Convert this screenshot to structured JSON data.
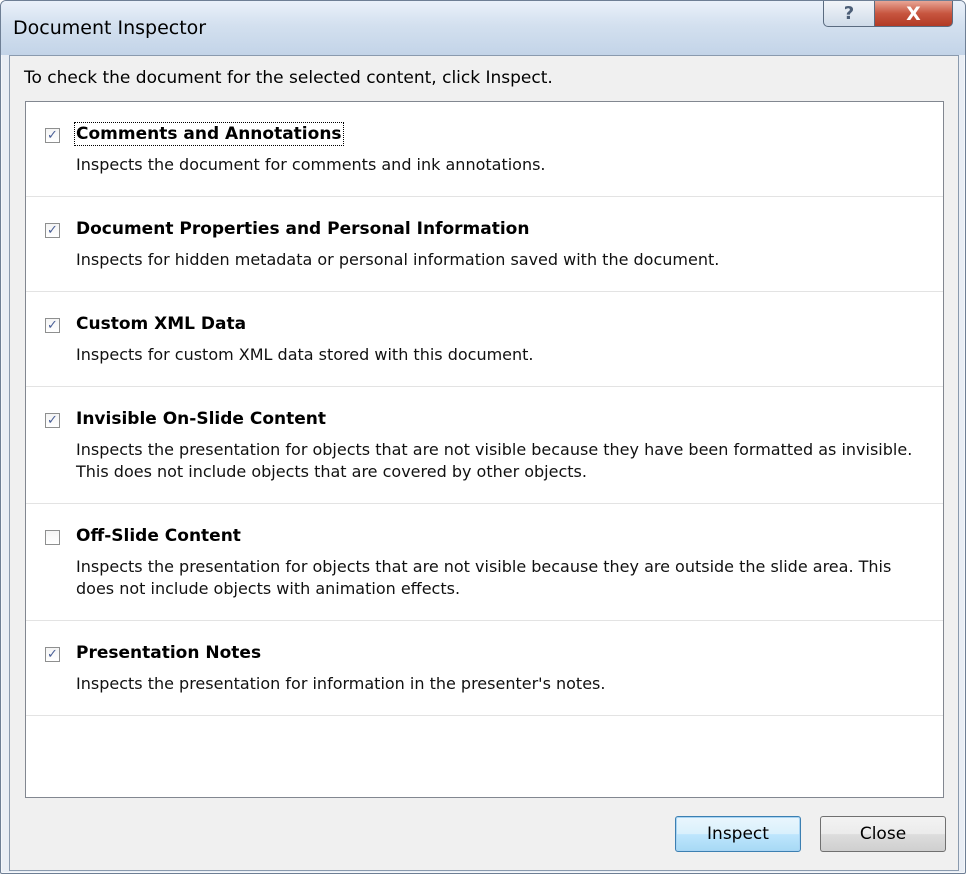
{
  "window": {
    "title": "Document Inspector",
    "help_glyph": "?",
    "close_glyph": "X"
  },
  "instruction": "To check the document for the selected content, click Inspect.",
  "items": [
    {
      "title": "Comments and Annotations",
      "description": "Inspects the document for comments and ink annotations.",
      "checked": true,
      "check_glyph": "✓"
    },
    {
      "title": "Document Properties and Personal Information",
      "description": "Inspects for hidden metadata or personal information saved with the document.",
      "checked": true,
      "check_glyph": "✓"
    },
    {
      "title": "Custom XML Data",
      "description": "Inspects for custom XML data stored with this document.",
      "checked": true,
      "check_glyph": "✓"
    },
    {
      "title": "Invisible On-Slide Content",
      "description": "Inspects the presentation for objects that are not visible because they have been formatted as invisible. This does not include objects that are covered by other objects.",
      "checked": true,
      "check_glyph": "✓"
    },
    {
      "title": "Off-Slide Content",
      "description": "Inspects the presentation for objects that are not visible because they are outside the slide area. This does not include objects with animation effects.",
      "checked": false,
      "check_glyph": ""
    },
    {
      "title": "Presentation Notes",
      "description": "Inspects the presentation for information in the presenter's notes.",
      "checked": true,
      "check_glyph": "✓"
    }
  ],
  "buttons": {
    "inspect": "Inspect",
    "close": "Close"
  }
}
